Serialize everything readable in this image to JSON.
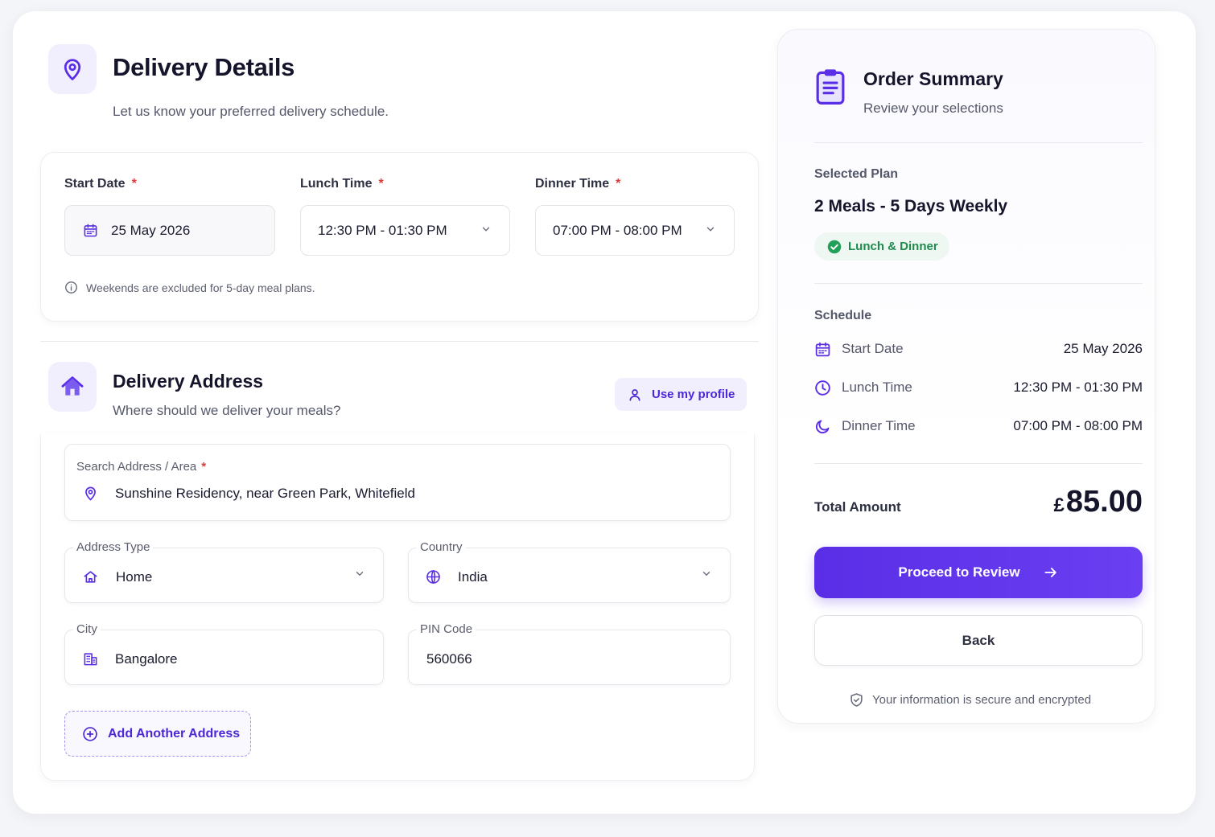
{
  "delivery": {
    "title": "Delivery Details",
    "subtitle": "Let us know your preferred delivery schedule.",
    "start_date_label": "Start Date",
    "lunch_time_label": "Lunch Time",
    "dinner_time_label": "Dinner Time",
    "required_mark": "*",
    "start_date_value": "25 May 2026",
    "lunch_time_value": "12:30 PM - 01:30 PM",
    "dinner_time_value": "07:00 PM - 08:00 PM",
    "note": "Weekends are excluded for 5-day meal plans."
  },
  "address": {
    "title": "Delivery Address",
    "subtitle": "Where should we deliver your meals?",
    "use_profile": "Use my profile",
    "search_label": "Search Address / Area",
    "search_value": "Sunshine Residency, near Green Park, Whitefield",
    "type_label": "Address Type",
    "type_value": "Home",
    "country_label": "Country",
    "country_value": "India",
    "city_label": "City",
    "city_value": "Bangalore",
    "pin_label": "PIN Code",
    "pin_value": "560066",
    "add_another": "Add Another Address"
  },
  "summary": {
    "title": "Order Summary",
    "subtitle": "Review your selections",
    "plan_label": "Selected Plan",
    "plan_name": "2 Meals - 5 Days Weekly",
    "plan_badge": "Lunch & Dinner",
    "schedule_label": "Schedule",
    "start_date_label": "Start Date",
    "start_date_value": "25 May 2026",
    "lunch_label": "Lunch Time",
    "lunch_value": "12:30 PM - 01:30 PM",
    "dinner_label": "Dinner Time",
    "dinner_value": "07:00 PM - 08:00 PM",
    "total_label": "Total Amount",
    "currency": "£",
    "total_value": "85.00",
    "proceed": "Proceed to Review",
    "back": "Back",
    "secure_note": "Your information is secure and encrypted"
  },
  "colors": {
    "accent": "#5a2ee6",
    "success": "#22a05a",
    "required": "#e03a3a"
  }
}
